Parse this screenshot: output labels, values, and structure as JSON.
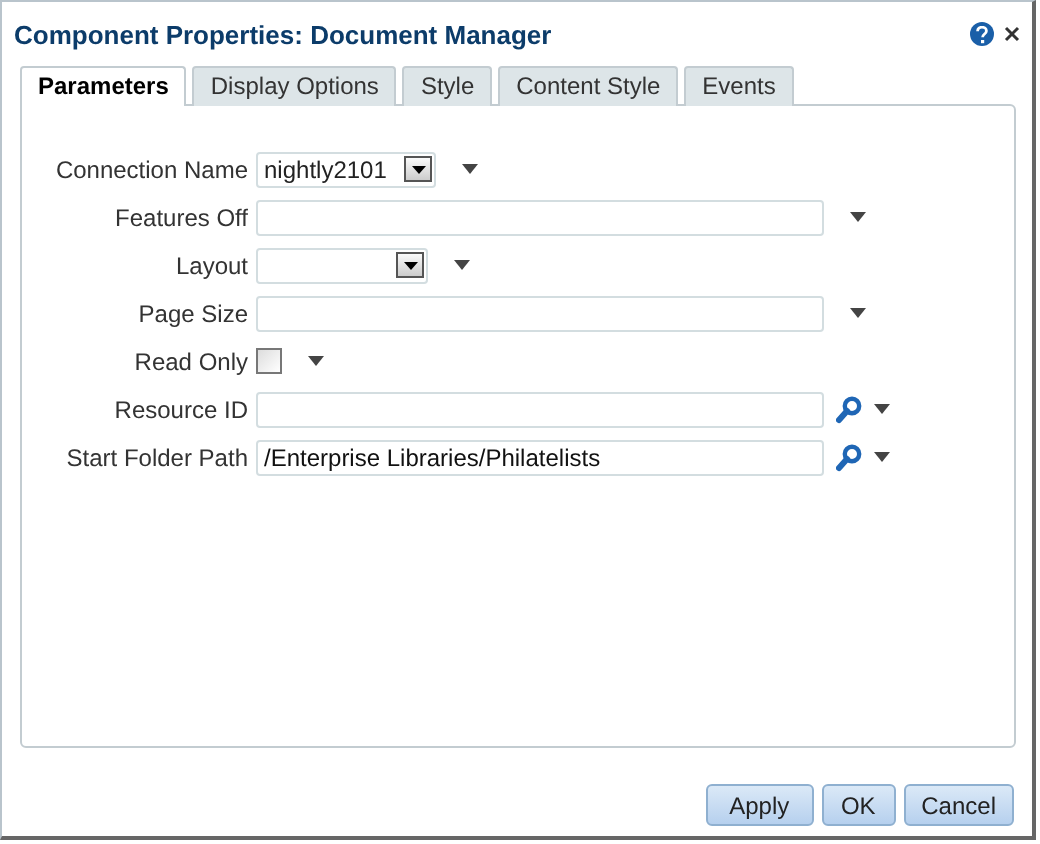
{
  "window": {
    "title": "Component Properties: Document Manager"
  },
  "tabs": [
    {
      "label": "Parameters",
      "selected": true
    },
    {
      "label": "Display Options",
      "selected": false
    },
    {
      "label": "Style",
      "selected": false
    },
    {
      "label": "Content Style",
      "selected": false
    },
    {
      "label": "Events",
      "selected": false
    }
  ],
  "fields": [
    {
      "label": "Connection Name",
      "kind": "select",
      "value": "nightly2101"
    },
    {
      "label": "Features Off",
      "kind": "text"
    },
    {
      "label": "Layout",
      "kind": "select"
    },
    {
      "label": "Page Size",
      "kind": "text"
    },
    {
      "label": "Read Only",
      "kind": "checkbox",
      "checked": false
    },
    {
      "label": "Resource ID",
      "kind": "search"
    },
    {
      "label": "Start Folder Path",
      "kind": "search",
      "value": "/Enterprise Libraries/Philatelists"
    }
  ],
  "buttons": [
    "Apply",
    "OK",
    "Cancel"
  ]
}
